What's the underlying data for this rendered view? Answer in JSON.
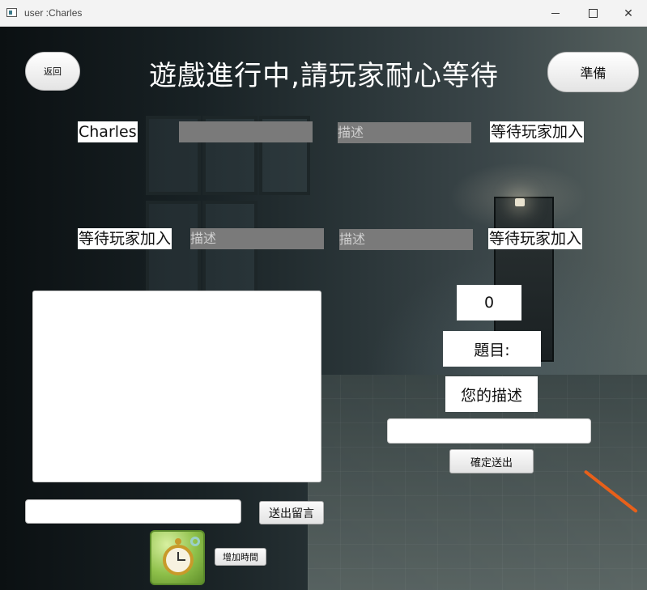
{
  "window": {
    "title": "user :Charles",
    "minimize_icon": "minimize-icon",
    "maximize_icon": "maximize-icon",
    "close_icon": "close-icon"
  },
  "header": {
    "back_label": "返回",
    "status_text": "遊戲進行中,請玩家耐心等待",
    "ready_label": "準備"
  },
  "players": [
    {
      "name": "Charles",
      "description": ""
    },
    {
      "name": "",
      "description": "描述"
    },
    {
      "name": "等待玩家加入",
      "description": ""
    },
    {
      "name": "等待玩家加入",
      "description": "描述"
    },
    {
      "name": "",
      "description": "描述"
    },
    {
      "name": "等待玩家加入",
      "description": ""
    }
  ],
  "chat": {
    "messages": [],
    "input_value": "",
    "send_label": "送出留言"
  },
  "add_time": {
    "icon": "pocket-watch-icon",
    "label": "增加時間"
  },
  "game": {
    "score": "0",
    "topic_label": "題目:",
    "your_description_label": "您的描述",
    "description_input_value": "",
    "submit_label": "確定送出"
  },
  "colors": {
    "accent_stroke": "#e8601a",
    "placeholder_box": "#7a7a7a"
  }
}
